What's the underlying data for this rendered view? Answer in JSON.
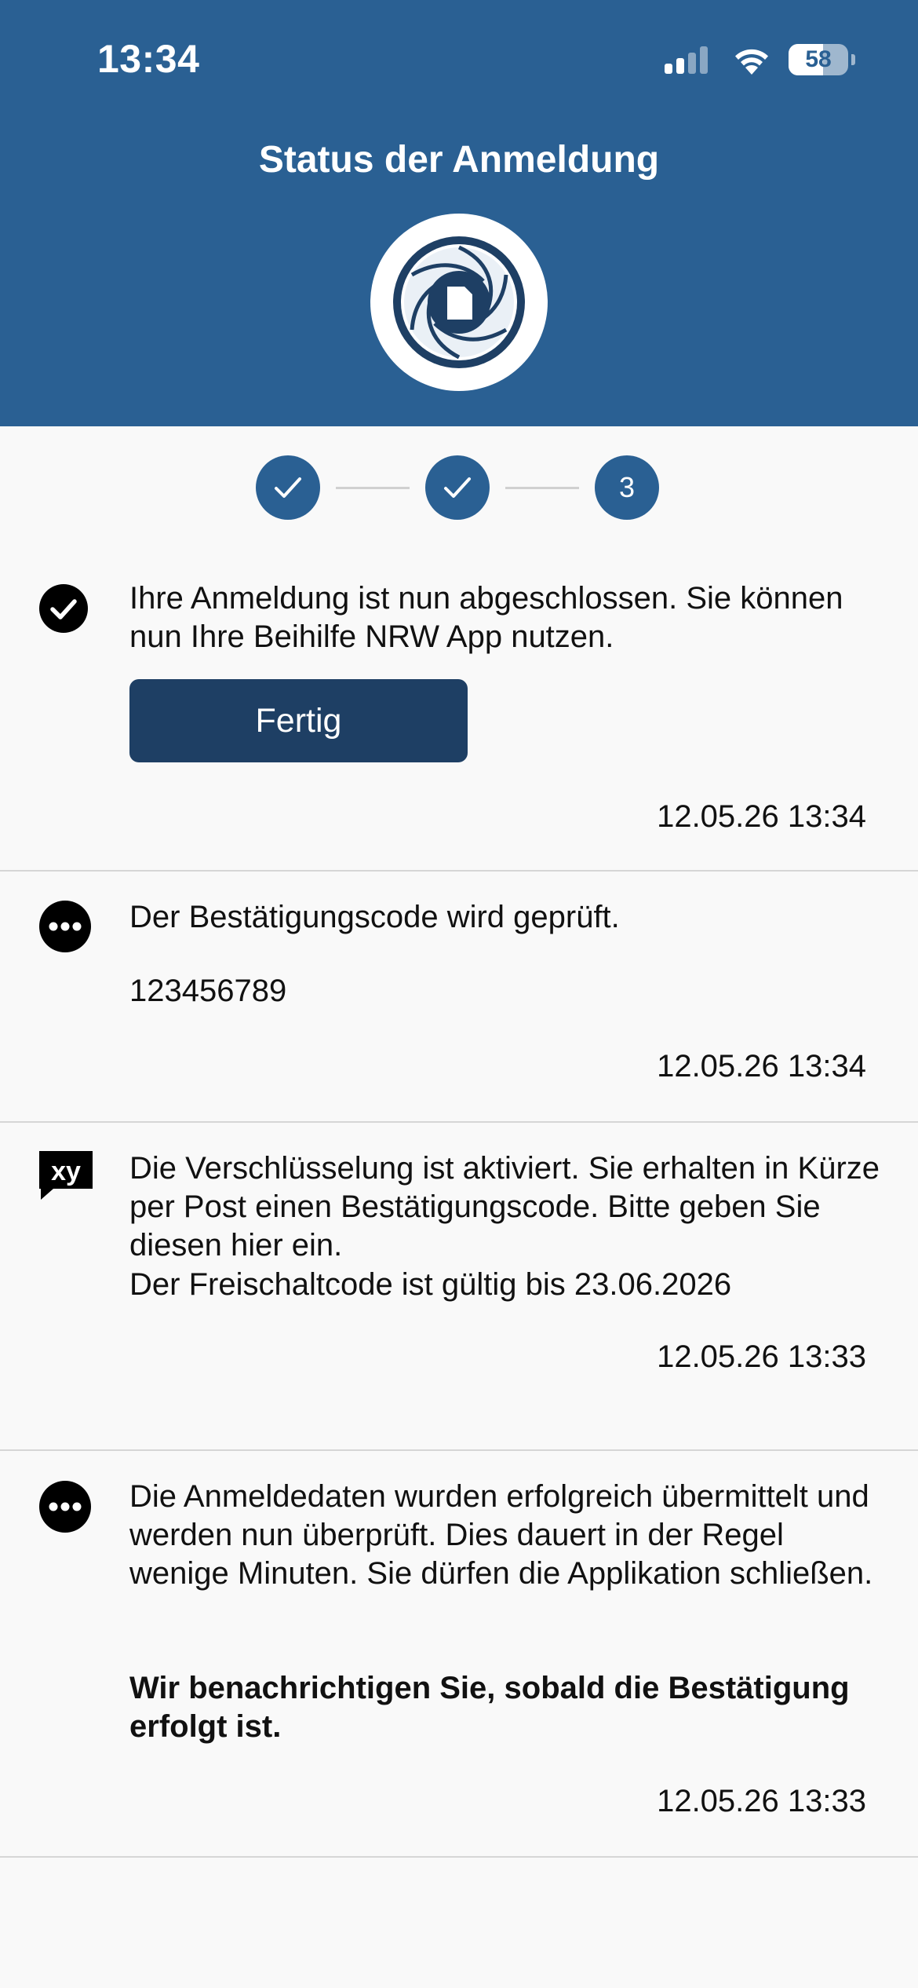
{
  "status_bar": {
    "time": "13:34",
    "battery": "58",
    "battery_level": 0.58,
    "signal_bars": 2,
    "icons": [
      "cellular-signal-icon",
      "wifi-icon",
      "battery-icon"
    ]
  },
  "header": {
    "title": "Status der Anmeldung",
    "logo_icon": "app-logo-aperture-icon",
    "background": "#2a6093"
  },
  "stepper": {
    "steps": [
      {
        "state": "done",
        "icon": "checkmark-icon"
      },
      {
        "state": "done",
        "icon": "checkmark-icon"
      },
      {
        "state": "current",
        "label": "3"
      }
    ],
    "active_color": "#2a6093"
  },
  "entries": [
    {
      "icon": "check-circle-icon",
      "message": "Ihre Anmeldung ist nun abgeschlossen. Sie können nun Ihre Beihilfe NRW App nutzen.",
      "button_label": "Fertig",
      "timestamp": "12.05.26 13:34"
    },
    {
      "icon": "more-dots-circle-icon",
      "message": "Der Bestätigungscode wird geprüft.",
      "code": "123456789",
      "timestamp": "12.05.26 13:34"
    },
    {
      "icon": "xy-speech-bubble-icon",
      "icon_text": "xy",
      "message": "Die Verschlüsselung ist aktiviert. Sie erhalten in Kürze per Post einen Bestätigungscode. Bitte geben Sie diesen hier ein.",
      "validity": "Der Freischaltcode ist gültig bis 23.06.2026",
      "timestamp": "12.05.26 13:33"
    },
    {
      "icon": "more-dots-circle-icon",
      "message": "Die Anmeldedaten wurden erfolgreich übermittelt und werden nun überprüft. Dies dauert in der Regel wenige Minuten. Sie dürfen die Applikation schließen.",
      "notice": "Wir benachrichtigen Sie, sobald die Bestätigung erfolgt ist.",
      "timestamp": "12.05.26 13:33"
    }
  ],
  "colors": {
    "primary": "#2a6093",
    "button": "#1e3f64",
    "background": "#f9f9f9",
    "divider": "#d6d6d6"
  }
}
